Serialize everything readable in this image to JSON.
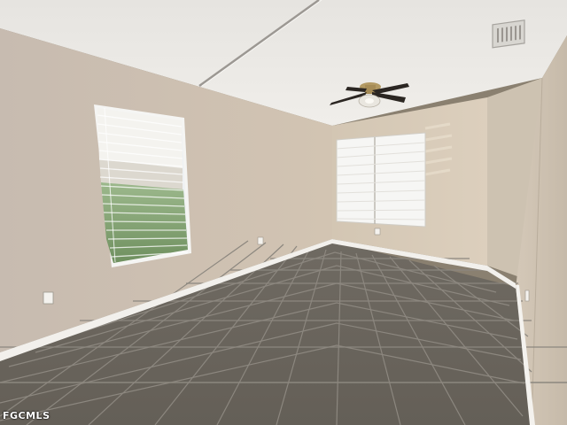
{
  "photo": {
    "watermark": "FGCMLS",
    "colors": {
      "ceiling": "#eceae6",
      "left_wall": "#cbbfb3",
      "back_wall": "#d6c9b7",
      "right_wall": "#c9beae",
      "floor_tile": "#6a655d",
      "grout": "#8a857d",
      "baseboard": "#f2f0ec",
      "window_glass": "#eef1f3",
      "foliage": "#7fa071",
      "blind": "#f3f3f1",
      "fan": "#2b2622",
      "fan_brass": "#b39a64"
    }
  }
}
